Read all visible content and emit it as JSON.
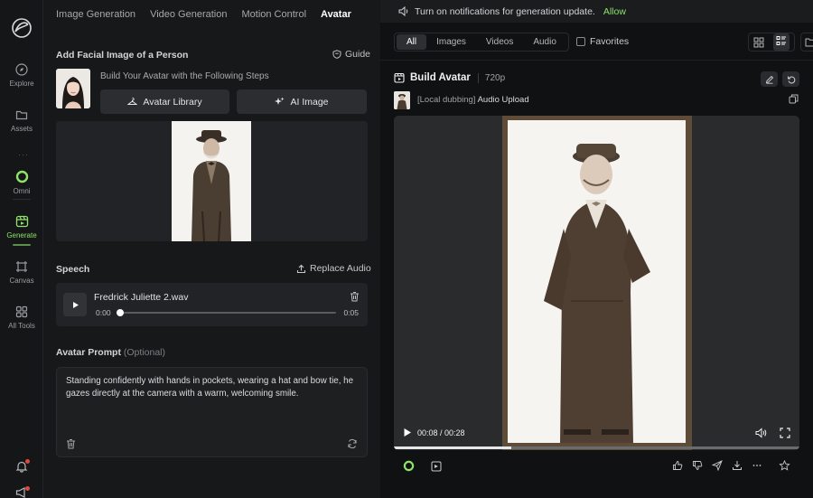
{
  "rail": {
    "items": [
      {
        "label": "Explore"
      },
      {
        "label": "Assets"
      },
      {
        "label": "Omni"
      },
      {
        "label": "Generate"
      },
      {
        "label": "Canvas"
      },
      {
        "label": "All Tools"
      }
    ],
    "dots": "···"
  },
  "topnav": [
    "Image Generation",
    "Video Generation",
    "Motion Control",
    "Avatar"
  ],
  "facial": {
    "title": "Add Facial Image of a Person",
    "guide": "Guide",
    "steps": "Build Your Avatar with the Following Steps",
    "library_btn": "Avatar Library",
    "ai_btn": "AI Image"
  },
  "speech": {
    "title": "Speech",
    "replace": "Replace Audio",
    "file": "Fredrick Juliette 2.wav",
    "time_start": "0:00",
    "time_end": "0:05",
    "progress": 0
  },
  "prompt": {
    "label": "Avatar Prompt",
    "optional": "(Optional)",
    "text": "Standing confidently with hands in pockets, wearing a hat and bow tie, he gazes directly at the camera with a warm, welcoming smile."
  },
  "notification": {
    "text": "Turn on notifications for generation update.",
    "allow": "Allow"
  },
  "filters": {
    "tabs": [
      "All",
      "Images",
      "Videos",
      "Audio"
    ],
    "active": "All",
    "favorites": "Favorites"
  },
  "card": {
    "title": "Build Avatar",
    "resolution": "720p",
    "tag": "[Local dubbing]",
    "source": "Audio Upload",
    "time": "00:08 / 00:28",
    "progress": 0.29
  },
  "colors": {
    "accent": "#8fe36a",
    "background": "#161719",
    "panel": "#222326"
  }
}
